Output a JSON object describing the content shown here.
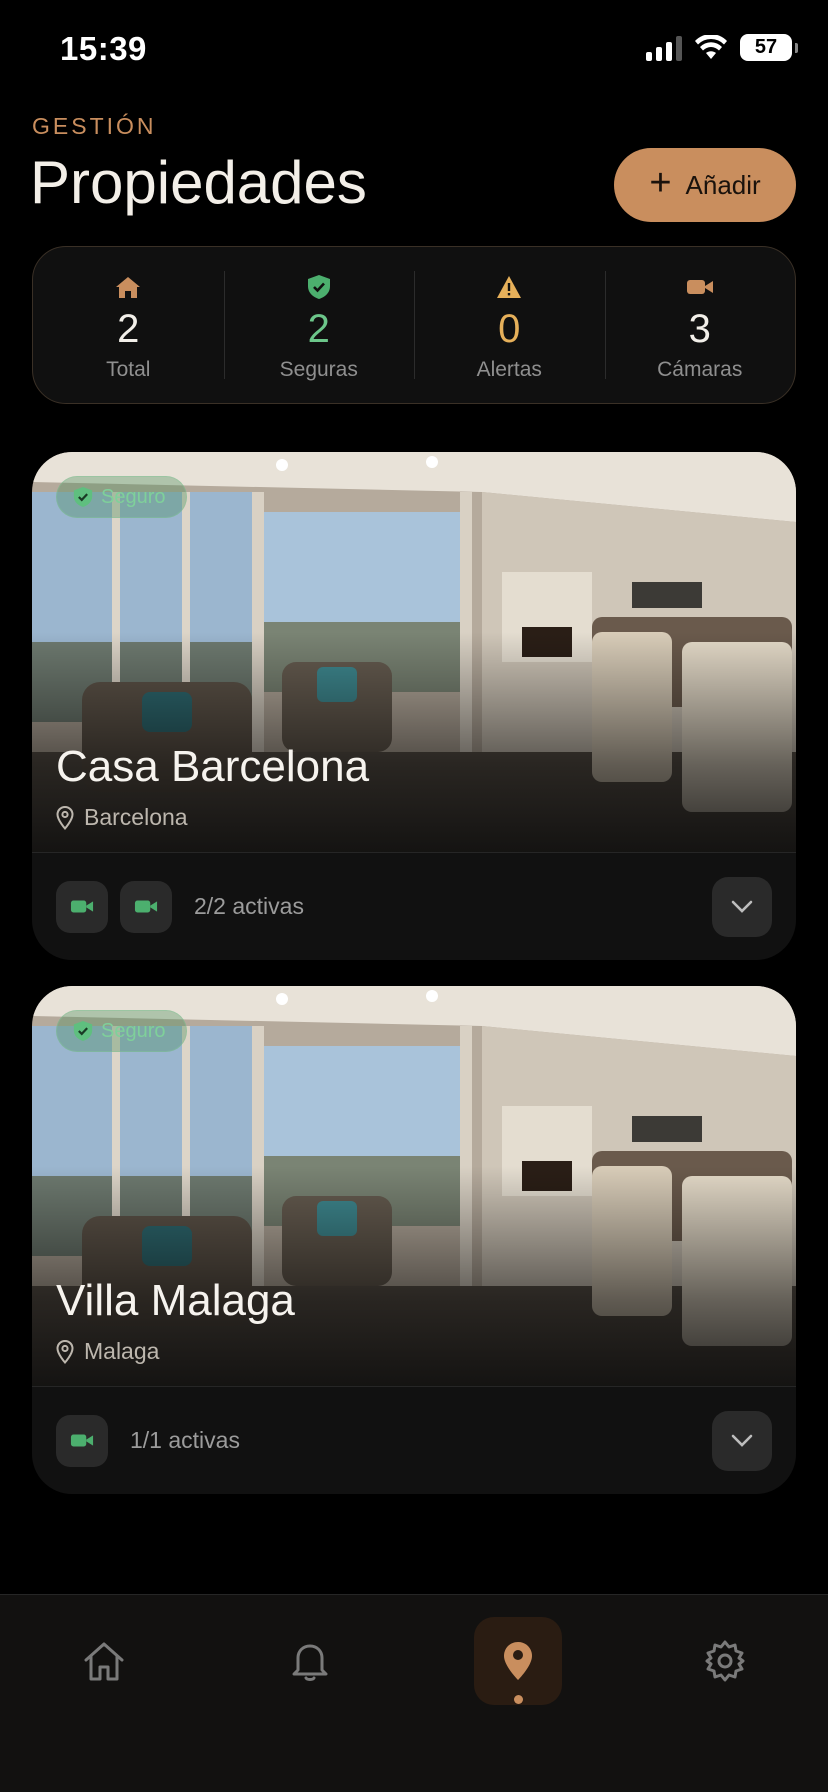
{
  "status_bar": {
    "time": "15:39",
    "battery": "57"
  },
  "header": {
    "eyebrow": "GESTIÓN",
    "title": "Propiedades",
    "add_label": "Añadir"
  },
  "stats": [
    {
      "icon": "home-icon",
      "value": "2",
      "label": "Total",
      "color": "#f2efe9",
      "icon_color": "#c98e5e"
    },
    {
      "icon": "shield-check-icon",
      "value": "2",
      "label": "Seguras",
      "color": "#6cc68a",
      "icon_color": "#4caf6e"
    },
    {
      "icon": "warning-icon",
      "value": "0",
      "label": "Alertas",
      "color": "#e6b05a",
      "icon_color": "#e6b05a"
    },
    {
      "icon": "video-camera-icon",
      "value": "3",
      "label": "Cámaras",
      "color": "#f2efe9",
      "icon_color": "#c98e5e"
    }
  ],
  "properties": [
    {
      "name": "Casa Barcelona",
      "location": "Barcelona",
      "status": "Seguro",
      "cameras": 2,
      "active_label": "2/2 activas"
    },
    {
      "name": "Villa Malaga",
      "location": "Malaga",
      "status": "Seguro",
      "cameras": 1,
      "active_label": "1/1 activas"
    }
  ],
  "tabs": [
    {
      "name": "home",
      "icon": "home-icon",
      "active": false
    },
    {
      "name": "alerts",
      "icon": "bell-icon",
      "active": false
    },
    {
      "name": "properties",
      "icon": "map-pin-icon",
      "active": true
    },
    {
      "name": "settings",
      "icon": "gear-icon",
      "active": false
    }
  ],
  "colors": {
    "accent": "#c98e5e",
    "safe": "#6cc68a",
    "warning": "#e6b05a",
    "background": "#000000",
    "card": "#111111"
  }
}
